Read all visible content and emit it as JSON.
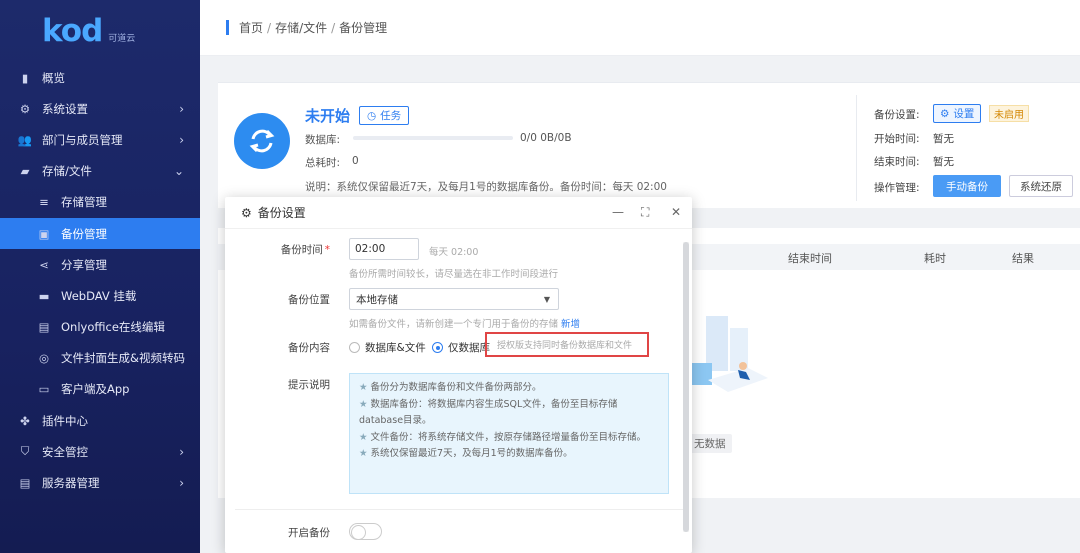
{
  "brand": {
    "logo_text": "kod",
    "logo_sub": "可道云",
    "accent": "#2d7df0"
  },
  "sidebar": {
    "items": [
      {
        "label": "概览",
        "icon": "chart-bar-icon",
        "sub": false,
        "active": false,
        "arrow": ""
      },
      {
        "label": "系统设置",
        "icon": "gear-icon",
        "sub": false,
        "active": false,
        "arrow": "›"
      },
      {
        "label": "部门与成员管理",
        "icon": "users-icon",
        "sub": false,
        "active": false,
        "arrow": "›"
      },
      {
        "label": "存储/文件",
        "icon": "folder-icon",
        "sub": false,
        "active": false,
        "arrow": "⌄"
      },
      {
        "label": "存储管理",
        "icon": "database-icon",
        "sub": true,
        "active": false,
        "arrow": ""
      },
      {
        "label": "备份管理",
        "icon": "backup-icon",
        "sub": true,
        "active": true,
        "arrow": ""
      },
      {
        "label": "分享管理",
        "icon": "share-icon",
        "sub": true,
        "active": false,
        "arrow": ""
      },
      {
        "label": "WebDAV 挂载",
        "icon": "webdav-icon",
        "sub": true,
        "active": false,
        "arrow": ""
      },
      {
        "label": "Onlyoffice在线编辑",
        "icon": "office-icon",
        "sub": true,
        "active": false,
        "arrow": ""
      },
      {
        "label": "文件封面生成&视频转码",
        "icon": "video-icon",
        "sub": true,
        "active": false,
        "arrow": ""
      },
      {
        "label": "客户端及App",
        "icon": "monitor-icon",
        "sub": true,
        "active": false,
        "arrow": ""
      },
      {
        "label": "插件中心",
        "icon": "plugin-icon",
        "sub": false,
        "active": false,
        "arrow": ""
      },
      {
        "label": "安全管控",
        "icon": "shield-icon",
        "sub": false,
        "active": false,
        "arrow": "›"
      },
      {
        "label": "服务器管理",
        "icon": "server-icon",
        "sub": false,
        "active": false,
        "arrow": "›"
      }
    ]
  },
  "header": {
    "breadcrumb": [
      "首页",
      "存储/文件",
      "备份管理"
    ],
    "sep": "/"
  },
  "status": {
    "title": "未开始",
    "task_label": "任务",
    "db_label": "数据库:",
    "db_value": "0/0  0B/0B",
    "progress": 0,
    "elapsed_label": "总耗时:",
    "elapsed_value": "0",
    "note": "说明：系统仅保留最近7天，及每月1号的数据库备份。备份时间：每天 02:00"
  },
  "side": {
    "backup_setting_label": "备份设置:",
    "setting_btn": "设置",
    "disabled_tag": "未启用",
    "start_label": "开始时间:",
    "start_value": "暂无",
    "end_label": "结束时间:",
    "end_value": "暂无",
    "ops_label": "操作管理:",
    "manual_btn": "手动备份",
    "restore_btn": "系统还原"
  },
  "table": {
    "columns": [
      "结束时间",
      "耗时",
      "结果"
    ],
    "empty_text": "无数据"
  },
  "dialog": {
    "title": "备份设置",
    "time_label": "备份时间",
    "time_value": "02:00",
    "time_suffix": "每天 02:00",
    "time_hint": "备份所需时间较长，请尽量选在非工作时间段进行",
    "location_label": "备份位置",
    "location_value": "本地存储",
    "location_hint": "如需备份文件，请新创建一个专门用于备份的存储",
    "location_link": "新增",
    "content_label": "备份内容",
    "content_options": [
      "数据库&文件",
      "仅数据库"
    ],
    "content_selected": 1,
    "content_note": "授权版支持同时备份数据库和文件",
    "tips_label": "提示说明",
    "tips": [
      "备份分为数据库备份和文件备份两部分。",
      "数据库备份：将数据库内容生成SQL文件，备份至目标存储database目录。",
      "文件备份：将系统存储文件，按原存储路径增量备份至目标存储。",
      "系统仅保留最近7天，及每月1号的数据库备份。"
    ],
    "enable_label": "开启备份",
    "enable_on": false
  }
}
